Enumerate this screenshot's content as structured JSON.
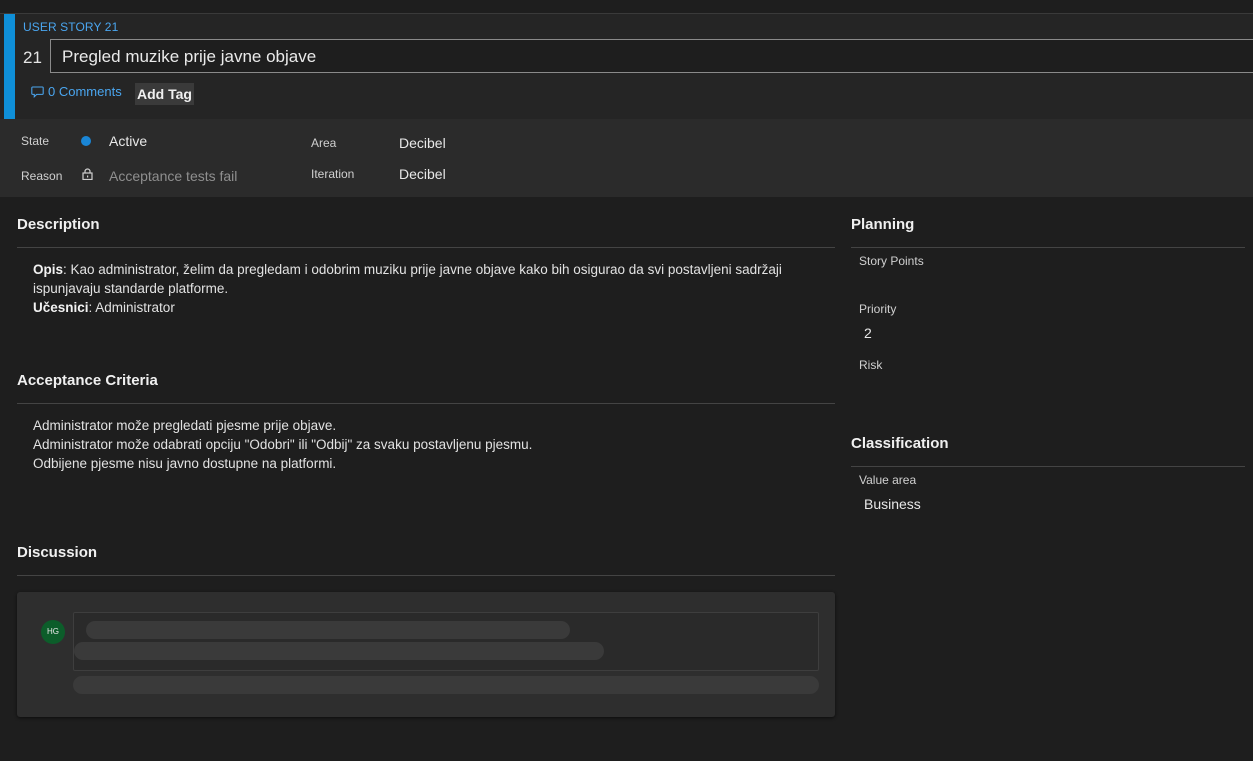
{
  "header": {
    "work_item_type": "USER STORY 21",
    "id": "21",
    "title": "Pregled muzike prije javne objave",
    "comments_label": "0 Comments",
    "add_tag_label": "Add Tag",
    "accent_color": "#0f8fd8",
    "link_color": "#4aa6f0"
  },
  "fields": {
    "state_label": "State",
    "state_value": "Active",
    "state_color": "#1a86d6",
    "reason_label": "Reason",
    "reason_value": "Acceptance tests fail",
    "area_label": "Area",
    "area_value": "Decibel",
    "iteration_label": "Iteration",
    "iteration_value": "Decibel"
  },
  "description": {
    "title": "Description",
    "opis_label": "Opis",
    "opis_text": ": Kao administrator, želim da pregledam i odobrim muziku prije javne objave kako bih osigurao da svi postavljeni sadržaji ispunjavaju standarde platforme.",
    "ucesnici_label": "Učesnici",
    "ucesnici_text": ": Administrator"
  },
  "acceptance": {
    "title": "Acceptance Criteria",
    "lines": [
      "Administrator može pregledati pjesme prije objave.",
      "Administrator može odabrati opciju \"Odobri\" ili \"Odbij\" za svaku postavljenu pjesmu.",
      "Odbijene pjesme nisu javno dostupne na platformi."
    ]
  },
  "discussion": {
    "title": "Discussion",
    "avatar_initials": "HG"
  },
  "planning": {
    "title": "Planning",
    "story_points_label": "Story Points",
    "story_points_value": "",
    "priority_label": "Priority",
    "priority_value": "2",
    "risk_label": "Risk",
    "risk_value": ""
  },
  "classification": {
    "title": "Classification",
    "value_area_label": "Value area",
    "value_area_value": "Business"
  }
}
